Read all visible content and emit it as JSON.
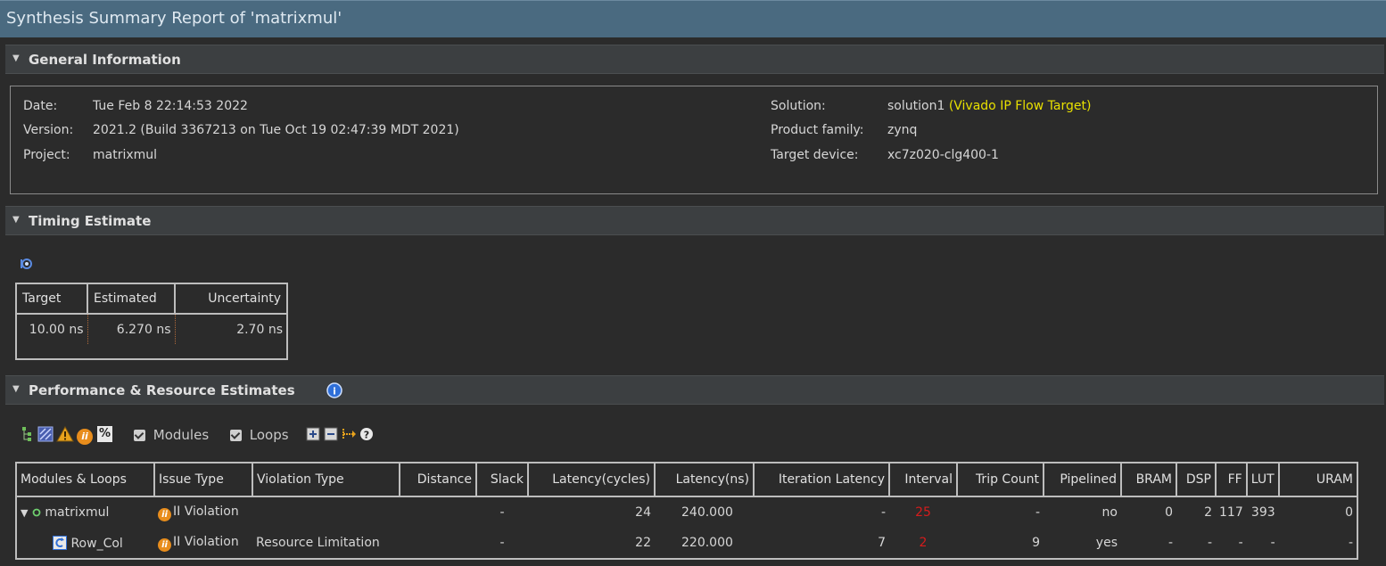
{
  "title": "Synthesis Summary Report of 'matrixmul'",
  "sections": {
    "general": "General Information",
    "timing": "Timing Estimate",
    "performance": "Performance & Resource Estimates"
  },
  "general_info": {
    "date_label": "Date:",
    "date_value": "Tue Feb 8 22:14:53 2022",
    "version_label": "Version:",
    "version_value": "2021.2 (Build 3367213 on Tue Oct 19 02:47:39 MDT 2021)",
    "project_label": "Project:",
    "project_value": "matrixmul",
    "solution_label": "Solution:",
    "solution_value": "solution1",
    "solution_target": "(Vivado IP Flow Target)",
    "family_label": "Product family:",
    "family_value": "zynq",
    "device_label": "Target device:",
    "device_value": "xc7z020-clg400-1"
  },
  "timing": {
    "headers": [
      "Target",
      "Estimated",
      "Uncertainty"
    ],
    "row": [
      "10.00 ns",
      "6.270 ns",
      "2.70 ns"
    ]
  },
  "toolbar": {
    "modules_label": "Modules",
    "loops_label": "Loops",
    "percent_label": "%",
    "ii_label": "ii"
  },
  "perf": {
    "headers": [
      "Modules & Loops",
      "Issue Type",
      "Violation Type",
      "Distance",
      "Slack",
      "Latency(cycles)",
      "Latency(ns)",
      "Iteration Latency",
      "Interval",
      "Trip Count",
      "Pipelined",
      "BRAM",
      "DSP",
      "FF",
      "LUT",
      "URAM"
    ],
    "rows": [
      {
        "name": "matrixmul",
        "issue": "II Violation",
        "violation": "",
        "distance": "",
        "slack": "-",
        "lat_cycles": "24",
        "lat_ns": "240.000",
        "iter_lat": "-",
        "interval": "25",
        "trip": "-",
        "pipelined": "no",
        "bram": "0",
        "dsp": "2",
        "ff": "117",
        "lut": "393",
        "uram": "0"
      },
      {
        "name": "Row_Col",
        "issue": "II Violation",
        "violation": "Resource Limitation",
        "distance": "",
        "slack": "-",
        "lat_cycles": "22",
        "lat_ns": "220.000",
        "iter_lat": "7",
        "interval": "2",
        "trip": "9",
        "pipelined": "yes",
        "bram": "-",
        "dsp": "-",
        "ff": "-",
        "lut": "-",
        "uram": "-"
      }
    ]
  },
  "colors": {
    "title_bar": "#4a6a80",
    "header_bg": "#3c3f41",
    "bg": "#2b2b2b",
    "highlight_yellow": "#e8e000",
    "violation_red": "#d61c1c"
  }
}
